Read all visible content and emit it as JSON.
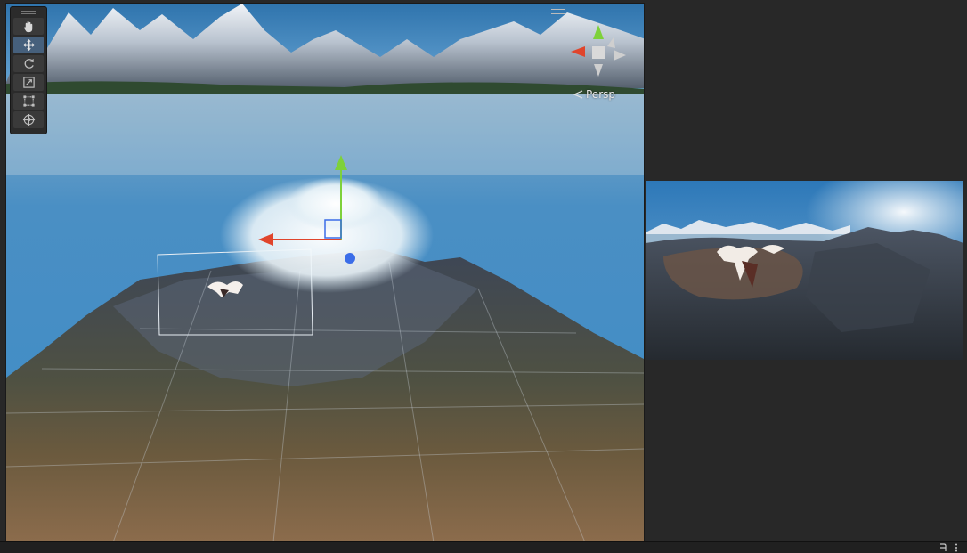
{
  "scene_view": {
    "camera_mode_label": "Persp",
    "tools": [
      {
        "name": "hand-tool",
        "icon": "hand-icon",
        "active": false
      },
      {
        "name": "move-tool",
        "icon": "move-arrows-icon",
        "active": true
      },
      {
        "name": "rotate-tool",
        "icon": "rotate-icon",
        "active": false
      },
      {
        "name": "scale-tool",
        "icon": "scale-icon",
        "active": false
      },
      {
        "name": "rect-tool",
        "icon": "rect-transform-icon",
        "active": false
      },
      {
        "name": "transform-tool",
        "icon": "transform-icon",
        "active": false
      }
    ],
    "gizmo_colors": {
      "x": "#e0452c",
      "y": "#7ed13a",
      "z": "#3b6de8"
    }
  },
  "status_bar": {
    "icons": [
      "debug-icon",
      "more-options-icon"
    ]
  },
  "colors": {
    "editor_bg": "#282828",
    "active_tool": "#46607c",
    "sky": "#3c8ac6",
    "water": "#3e8cc5"
  }
}
